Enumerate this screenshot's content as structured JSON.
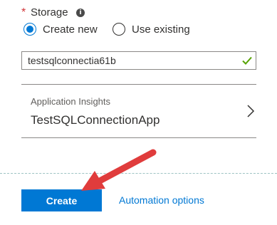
{
  "storage": {
    "required_marker": "*",
    "label": "Storage",
    "info_icon": "info-icon",
    "options": [
      {
        "label": "Create new",
        "selected": true
      },
      {
        "label": "Use existing",
        "selected": false
      }
    ],
    "name_value": "testsqlconnectia61b",
    "valid_icon": "checkmark-icon"
  },
  "app_insights": {
    "title": "Application Insights",
    "value": "TestSQLConnectionApp",
    "chevron_icon": "chevron-right-icon"
  },
  "footer": {
    "create_label": "Create",
    "automation_label": "Automation options"
  },
  "colors": {
    "accent": "#0078d4",
    "valid": "#57a300",
    "annotation_arrow": "#e03c3c",
    "required": "#d13438"
  }
}
